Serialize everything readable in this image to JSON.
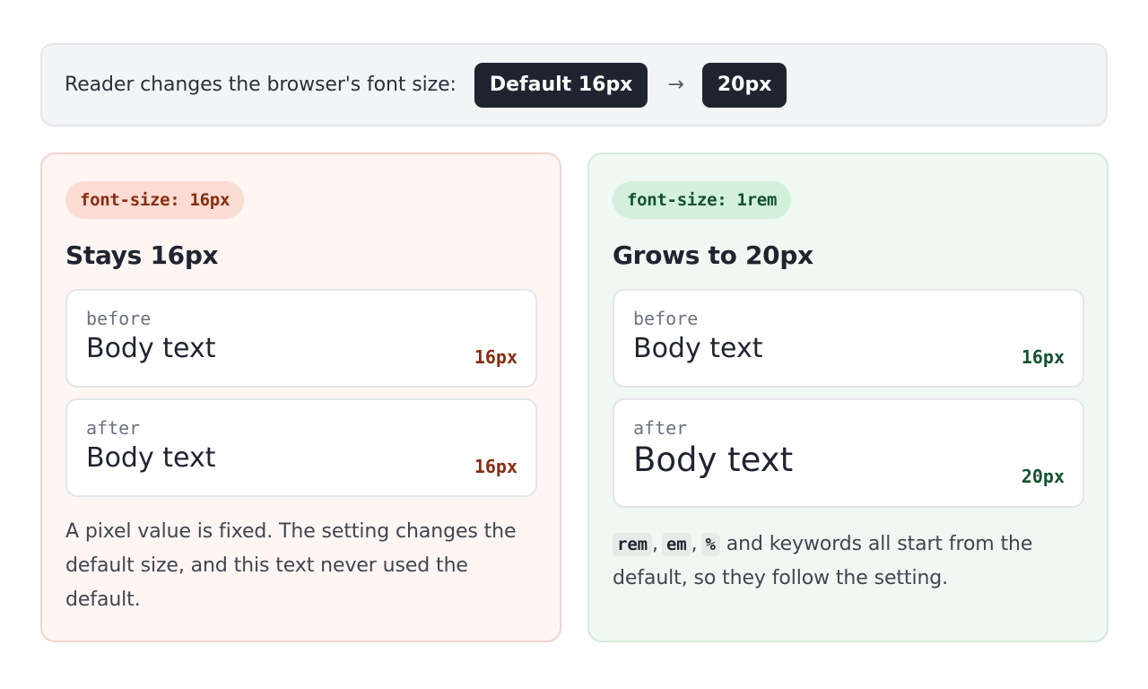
{
  "banner": {
    "lead": "Reader changes the browser's font size:",
    "from": "Default 16px",
    "arrow": "→",
    "to": "20px"
  },
  "left_card": {
    "tag": "font-size: 16px",
    "heading": "Stays 16px",
    "before": {
      "label": "before",
      "sample": "Body text",
      "size": "16px"
    },
    "after": {
      "label": "after",
      "sample": "Body text",
      "size": "16px"
    },
    "description": "A pixel value is fixed. The setting changes the default size, and this text never used the default."
  },
  "right_card": {
    "tag": "font-size: 1rem",
    "heading": "Grows to 20px",
    "before": {
      "label": "before",
      "sample": "Body text",
      "size": "16px"
    },
    "after": {
      "label": "after",
      "sample": "Body text",
      "size": "20px"
    },
    "units": [
      "rem",
      "em",
      "%"
    ],
    "description_suffix": "and keywords all start from the default, so they follow the setting."
  },
  "colors": {
    "dark": "#1f2430",
    "px_accent": "#8a2c10",
    "rem_accent": "#135132"
  }
}
